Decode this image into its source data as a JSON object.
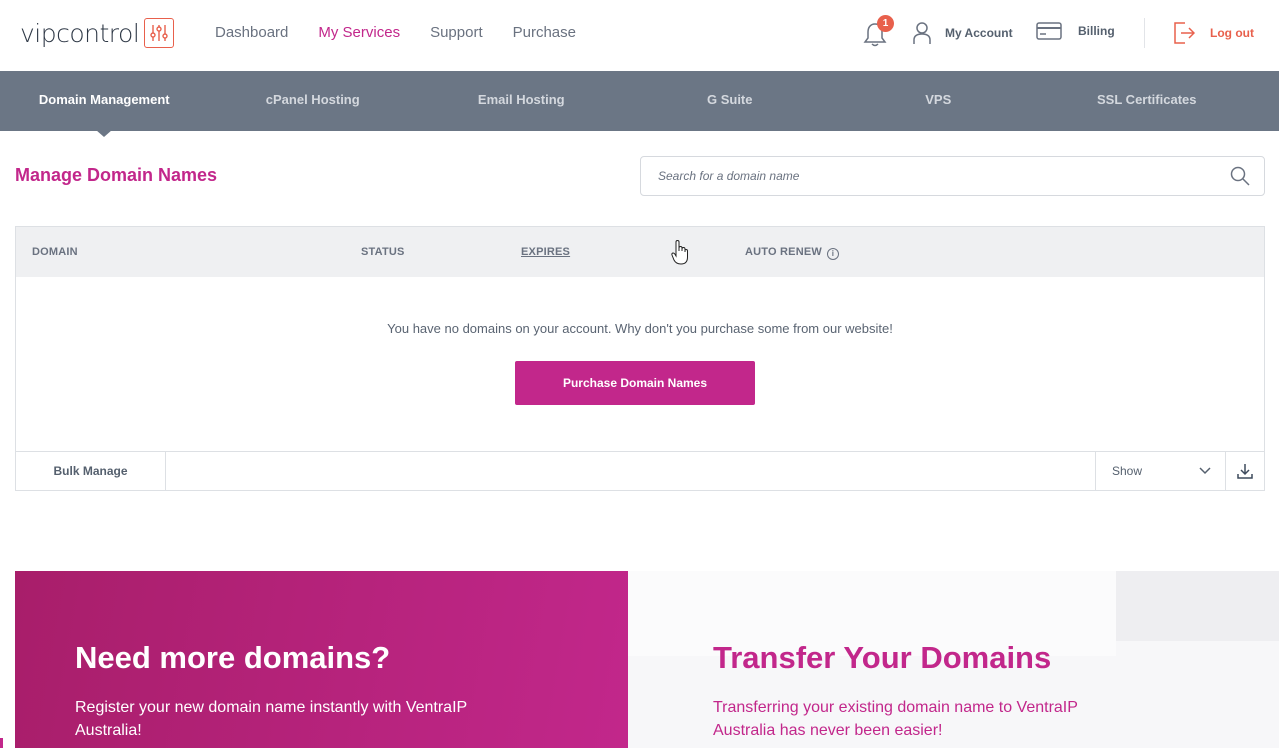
{
  "logo": {
    "text": "vipcontrol"
  },
  "nav": {
    "items": [
      {
        "label": "Dashboard",
        "active": false
      },
      {
        "label": "My Services",
        "active": true
      },
      {
        "label": "Support",
        "active": false
      },
      {
        "label": "Purchase",
        "active": false
      }
    ]
  },
  "header": {
    "notifications_count": "1",
    "account_label": "My Account",
    "billing_label": "Billing",
    "logout_label": "Log out"
  },
  "subnav": {
    "items": [
      {
        "label": "Domain Management",
        "active": true
      },
      {
        "label": "cPanel Hosting",
        "active": false
      },
      {
        "label": "Email Hosting",
        "active": false
      },
      {
        "label": "G Suite",
        "active": false
      },
      {
        "label": "VPS",
        "active": false
      },
      {
        "label": "SSL Certificates",
        "active": false
      }
    ]
  },
  "page": {
    "title": "Manage Domain Names",
    "search_placeholder": "Search for a domain name"
  },
  "table": {
    "columns": {
      "domain": "DOMAIN",
      "status": "STATUS",
      "expires": "EXPIRES",
      "auto_renew": "AUTO RENEW"
    },
    "empty_message": "You have no domains on your account. Why don't you purchase some from our website!",
    "purchase_button": "Purchase Domain Names",
    "bulk_manage": "Bulk Manage",
    "show_select": "Show"
  },
  "promo": {
    "left_title": "Need more domains?",
    "left_text": "Register your new domain name instantly with VentraIP Australia!",
    "right_title": "Transfer Your Domains",
    "right_text": "Transferring your existing domain name to VentraIP Australia has never been easier!"
  },
  "colors": {
    "brand": "#c2278b",
    "accent": "#e8604c",
    "subnav_bg": "#6b7685"
  }
}
